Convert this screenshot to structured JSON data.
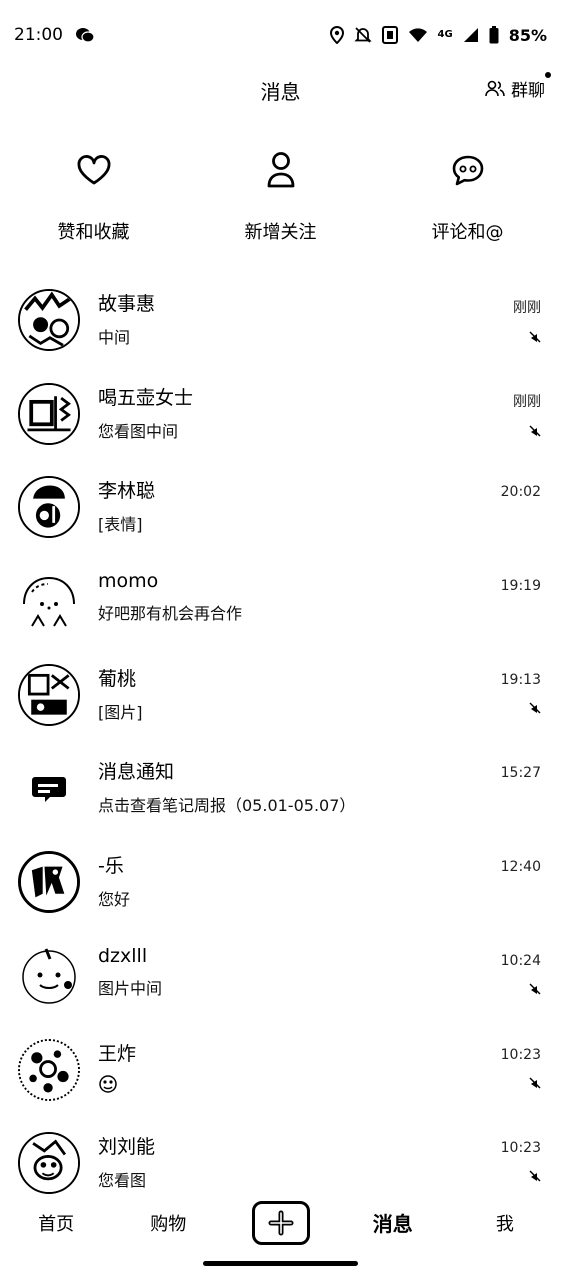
{
  "status_bar": {
    "time": "21:00",
    "network": "4G",
    "battery": "85%",
    "icons": [
      "wechat-icon",
      "location-icon",
      "bell-mute-icon",
      "nfc-icon",
      "wifi-icon",
      "signal-icon",
      "battery-icon"
    ]
  },
  "header": {
    "title": "消息",
    "group_chat_label": "群聊"
  },
  "quick_actions": [
    {
      "label": "赞和收藏",
      "icon": "heart-icon"
    },
    {
      "label": "新增关注",
      "icon": "person-icon"
    },
    {
      "label": "评论和@",
      "icon": "chat-bubble-icon"
    }
  ],
  "messages": [
    {
      "name": "故事惠",
      "preview": "中间",
      "time": "刚刚",
      "muted": true
    },
    {
      "name": "喝五壶女士",
      "preview": "您看图中间",
      "time": "刚刚",
      "muted": true
    },
    {
      "name": "李林聪",
      "preview": "[表情]",
      "time": "20:02",
      "muted": false
    },
    {
      "name": "momo",
      "preview": "好吧那有机会再合作",
      "time": "19:19",
      "muted": false
    },
    {
      "name": "葡桃",
      "preview": "[图片]",
      "time": "19:13",
      "muted": true
    },
    {
      "name": "消息通知",
      "preview": "点击查看笔记周报（05.01-05.07）",
      "time": "15:27",
      "muted": false
    },
    {
      "name": "-乐",
      "preview": "您好",
      "time": "12:40",
      "muted": false
    },
    {
      "name": "dzxlll",
      "preview": "图片中间",
      "time": "10:24",
      "muted": true
    },
    {
      "name": "王炸",
      "preview": "",
      "time": "10:23",
      "muted": true
    },
    {
      "name": "刘刘能",
      "preview": "您看图",
      "time": "10:23",
      "muted": true
    }
  ],
  "bottom_nav": {
    "home": "首页",
    "shop": "购物",
    "messages": "消息",
    "me": "我"
  }
}
